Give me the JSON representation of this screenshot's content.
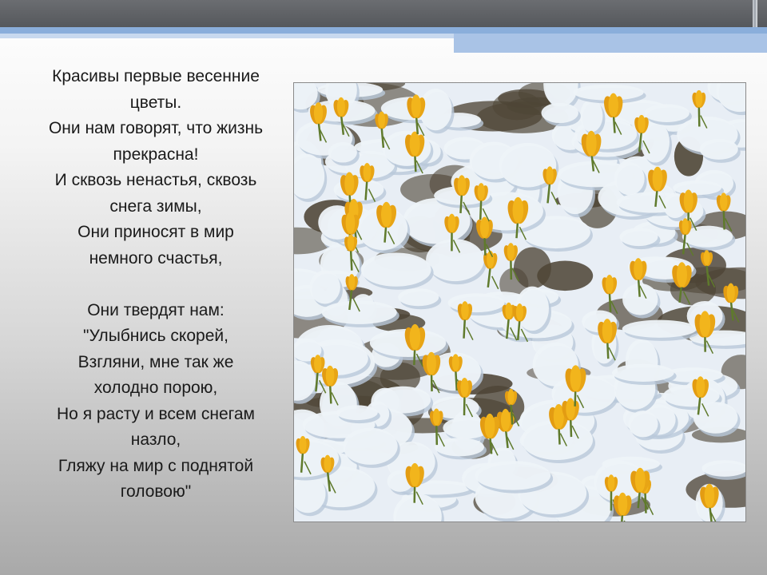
{
  "slide": {
    "poem_lines": [
      "Красивы первые весенние",
      "цветы.",
      "Они нам говорят, что жизнь",
      "прекрасна!",
      "И сквозь ненастья, сквозь",
      "снега зимы,",
      "Они приносят в мир",
      "немного счастья,",
      "Они твердят нам:",
      "\"Улыбнись скорей,",
      "Взгляни, мне так же",
      "холодно порою,",
      "Но я расту и всем снегам",
      "назло,",
      "Гляжу на мир с поднятой",
      "головою\""
    ],
    "photo": {
      "subject": "yellow crocuses blooming through snow",
      "colors": {
        "snow": "#eef3f8",
        "snow_shadow": "#b9c8d9",
        "earth": "#4e4536",
        "petal": "#f2b51c",
        "stem": "#5f7a2c"
      }
    },
    "colors": {
      "topbar": "#5b5e62",
      "accent_blue": "#8aaedb",
      "accent_light": "#c8d9ef"
    }
  }
}
